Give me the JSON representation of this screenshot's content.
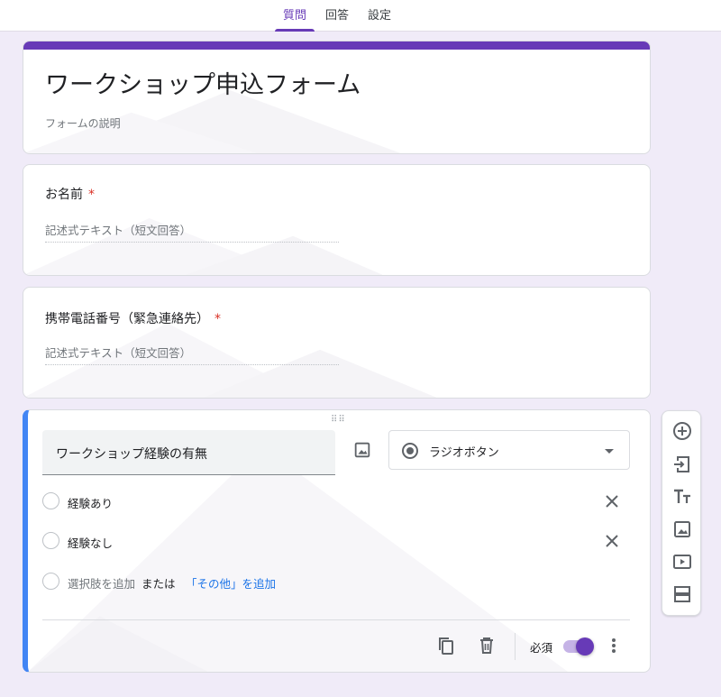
{
  "tabs": [
    {
      "label": "質問",
      "active": true
    },
    {
      "label": "回答",
      "active": false
    },
    {
      "label": "設定",
      "active": false
    }
  ],
  "form": {
    "title": "ワークショップ申込フォーム",
    "description": "フォームの説明"
  },
  "questions": [
    {
      "title": "お名前",
      "required_mark": "*",
      "answer_placeholder": "記述式テキスト（短文回答）"
    },
    {
      "title": "携帯電話番号（緊急連絡先）",
      "required_mark": "*",
      "answer_placeholder": "記述式テキスト（短文回答）"
    }
  ],
  "active_question": {
    "title": "ワークショップ経験の有無",
    "type_label": "ラジオボタン",
    "options": [
      "経験あり",
      "経験なし"
    ],
    "add_option": "選択肢を追加",
    "or_label": "または",
    "add_other": "「その他」を追加",
    "required_label": "必須",
    "required_on": true
  },
  "colors": {
    "accent": "#673ab7",
    "active_border": "#4285f4",
    "background": "#f0ebf8",
    "link": "#1a73e8"
  },
  "toolbar_icons": [
    "add-question-icon",
    "import-questions-icon",
    "add-title-icon",
    "add-image-icon",
    "add-video-icon",
    "add-section-icon"
  ]
}
